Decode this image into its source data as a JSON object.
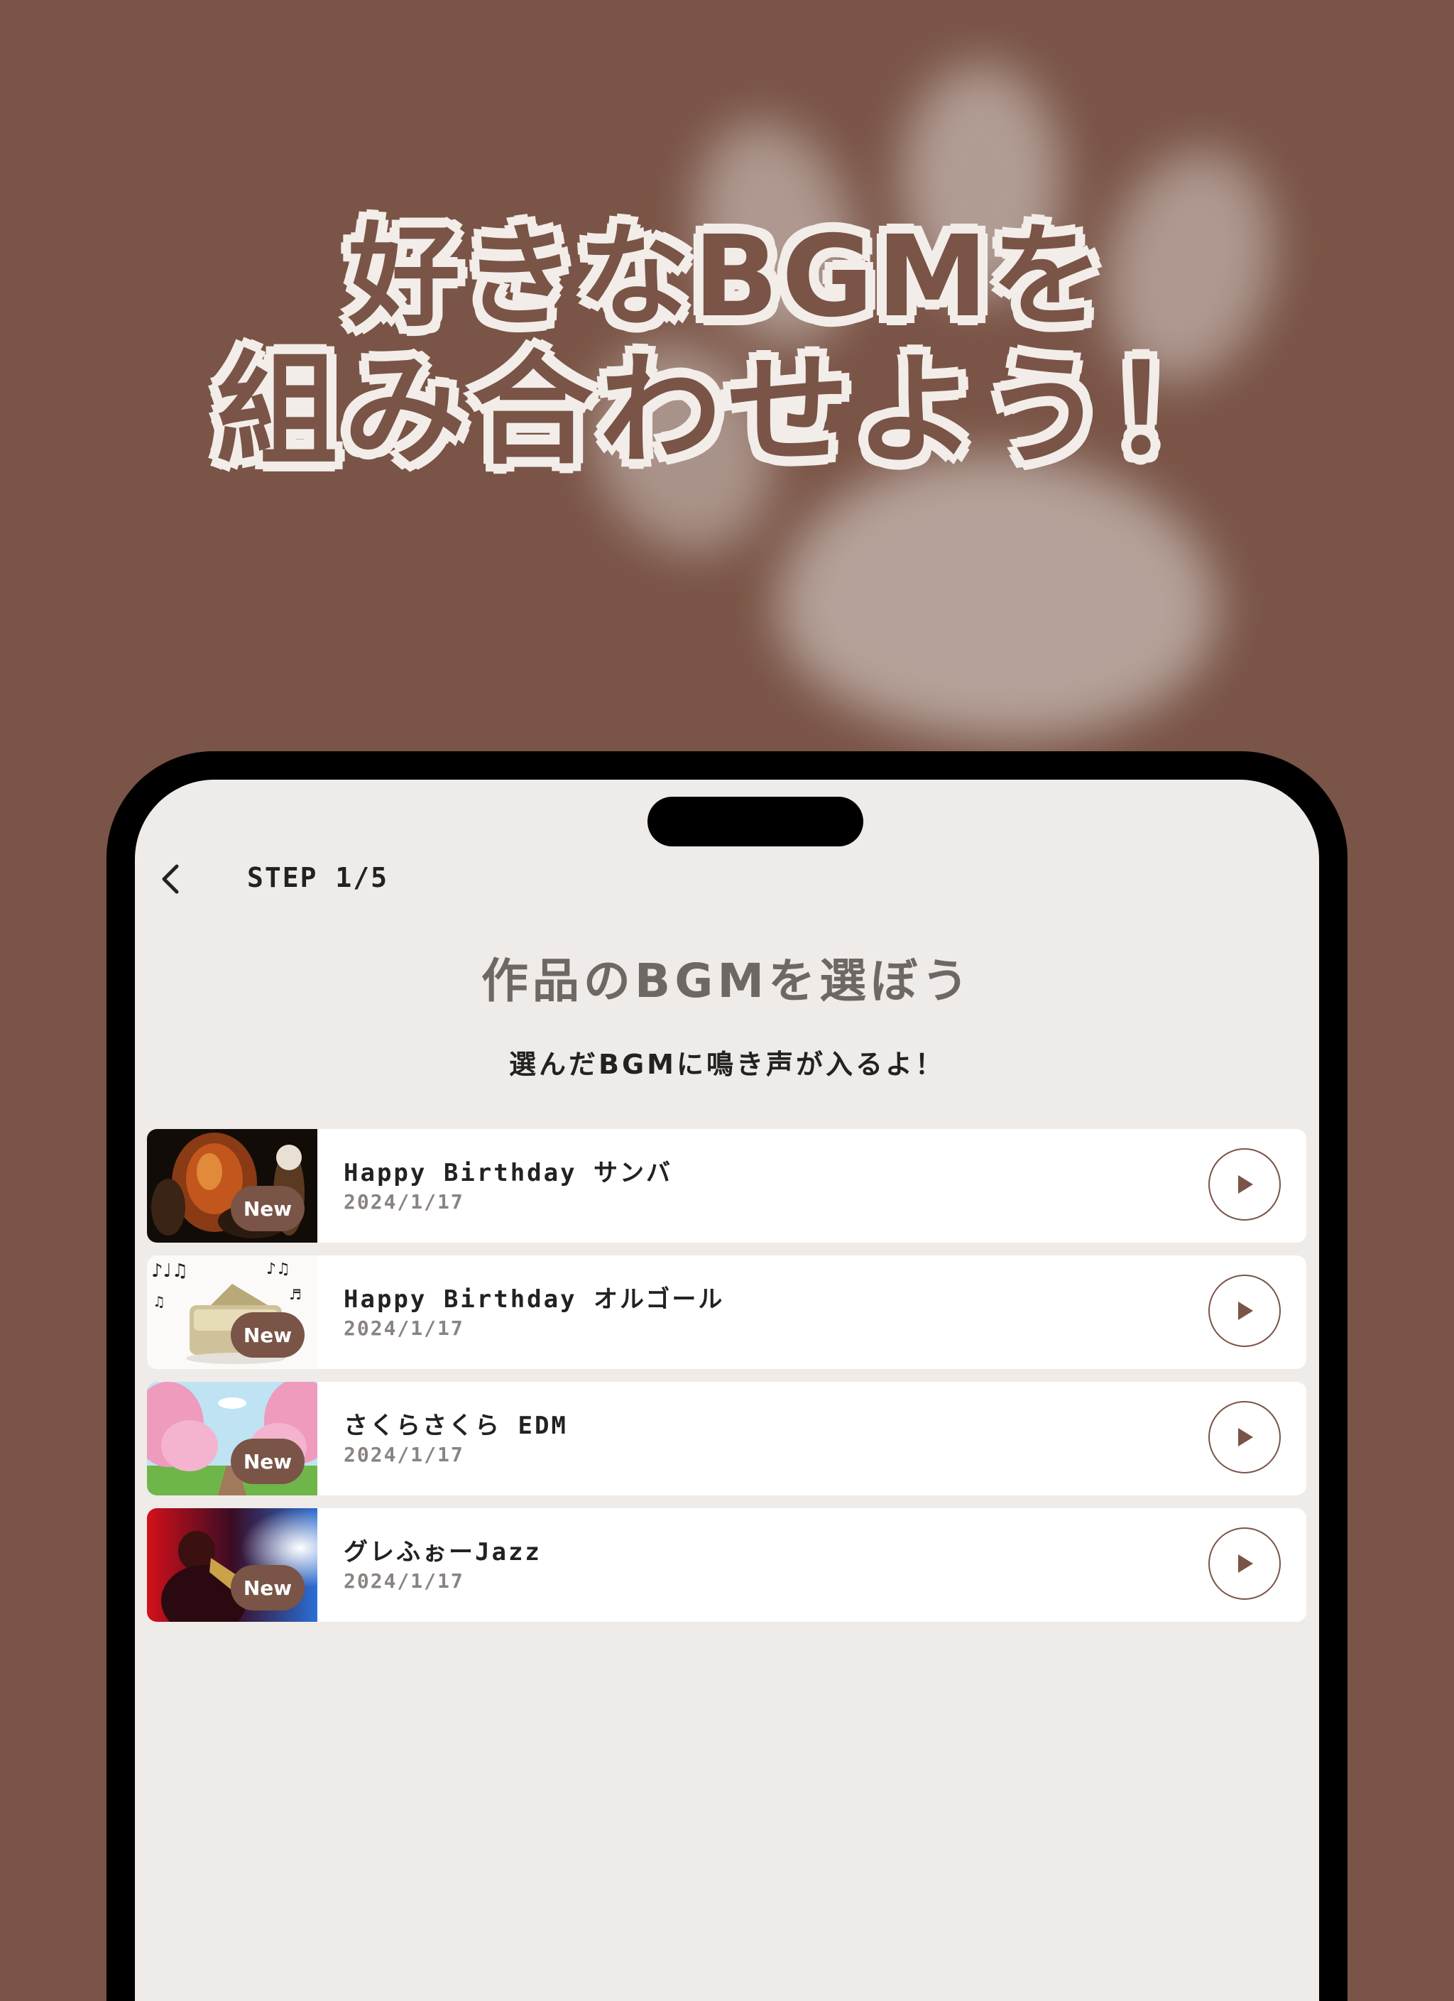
{
  "headline": {
    "line1": "好きなBGMを",
    "line2": "組み合わせよう！"
  },
  "header": {
    "step": "STEP 1/5",
    "back_icon": "chevron-left-icon"
  },
  "page": {
    "title": "作品のBGMを選ぼう",
    "subtitle": "選んだBGMに鳴き声が入るよ！"
  },
  "bgm_list": [
    {
      "title": "Happy Birthday サンバ",
      "date": "2024/1/17",
      "badge": "New",
      "thumbnail": "samba-dancers"
    },
    {
      "title": "Happy Birthday オルゴール",
      "date": "2024/1/17",
      "badge": "New",
      "thumbnail": "music-box"
    },
    {
      "title": "さくらさくら EDM",
      "date": "2024/1/17",
      "badge": "New",
      "thumbnail": "cherry-blossom-road"
    },
    {
      "title": "グレふぉーJazz",
      "date": "2024/1/17",
      "badge": "New",
      "thumbnail": "saxophone-player"
    }
  ],
  "colors": {
    "background": "#7a5446",
    "screen": "#efebe8",
    "accent": "#7a5446"
  }
}
